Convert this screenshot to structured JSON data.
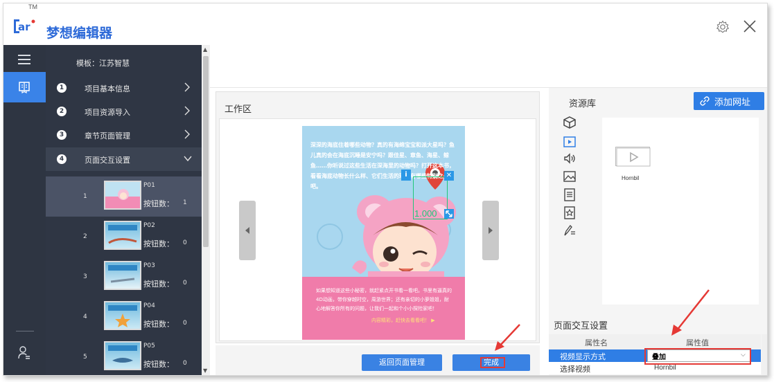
{
  "app": {
    "logo_text": "ar",
    "tm": "TM",
    "title_part1": "梦想",
    "title_part2": "编辑器"
  },
  "nav": {
    "template_label": "模板：江苏智慧",
    "items": [
      {
        "num": "1",
        "label": "项目基本信息"
      },
      {
        "num": "2",
        "label": "项目资源导入"
      },
      {
        "num": "3",
        "label": "章节页面管理"
      },
      {
        "num": "4",
        "label": "页面交互设置"
      }
    ],
    "pages": [
      {
        "index": "1",
        "name": "P01",
        "buttons_label": "按钮数：",
        "buttons_count": "1"
      },
      {
        "index": "2",
        "name": "P02",
        "buttons_label": "按钮数：",
        "buttons_count": "0"
      },
      {
        "index": "3",
        "name": "P03",
        "buttons_label": "按钮数：",
        "buttons_count": "0"
      },
      {
        "index": "4",
        "name": "P04",
        "buttons_label": "按钮数：",
        "buttons_count": "0"
      },
      {
        "index": "5",
        "name": "P05",
        "buttons_label": "按钮数：",
        "buttons_count": "0"
      }
    ]
  },
  "workarea": {
    "title": "工作区",
    "page_text": "深深的海底住着哪些动物？真的有海绵宝宝和派大星吗？鱼儿真的会在海底沉睡是安宁吗？跟佳星、章鱼、海星、鲸鱼……你听说过这些生活在深海里的动物吗？打开这本书，看看海底动物长什么样、它们生活的环境有哪些特别之处吧。",
    "pink_text": "如果想知道这些小秘密，就赶紧点开书看一看吧。书里有逼真的4D动画，带你穿越时空，周游世界；还有亲切的小萝姐姐，耐心地解答你所有的问题，让我们一起和个小小探险家吧！",
    "pink_link": "内容精彩，赶快去看看吧！ ▶",
    "marker_info": "i",
    "marker_close": "✕",
    "marker_scale": "1.000"
  },
  "buttons": {
    "back": "返回页面管理",
    "done": "完成"
  },
  "resources": {
    "title": "资源库",
    "add_url": "添加网址",
    "video_name": "Hornbil"
  },
  "interaction": {
    "title": "页面交互设置",
    "col_name": "属性名",
    "col_value": "属性值",
    "rows": [
      {
        "name": "视频显示方式",
        "value": "叠加"
      },
      {
        "name": "选择视频",
        "value": "Hornbil"
      }
    ]
  },
  "colors": {
    "accent": "#2f7ee5",
    "sidebar": "#2f3644",
    "highlight": "#e53935",
    "marker": "#1fc77a"
  }
}
